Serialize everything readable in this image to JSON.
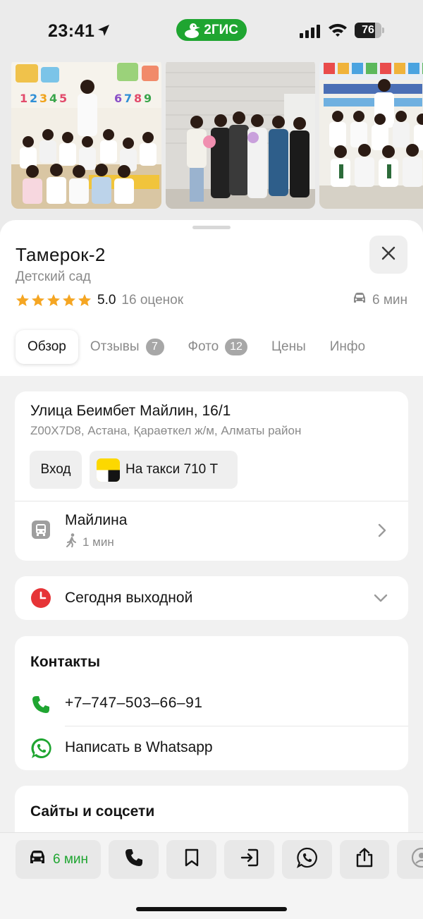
{
  "status_bar": {
    "time": "23:41",
    "brand_label": "2ГИС",
    "battery_level": 76,
    "battery_text": "76",
    "icons": [
      "location-arrow-icon",
      "cellular-signal-icon",
      "wifi-icon",
      "battery-icon"
    ]
  },
  "photos": [
    {
      "name": "group-photo-classroom"
    },
    {
      "name": "group-photo-teachers"
    },
    {
      "name": "group-photo-children"
    }
  ],
  "place": {
    "title": "Тамерок-2",
    "category": "Детский сад",
    "rating": "5.0",
    "stars": 5,
    "reviews_count": "16 оценок",
    "travel_time": "6 мин"
  },
  "tabs": [
    {
      "label": "Обзор",
      "badge": null,
      "active": true
    },
    {
      "label": "Отзывы",
      "badge": "7",
      "active": false
    },
    {
      "label": "Фото",
      "badge": "12",
      "active": false
    },
    {
      "label": "Цены",
      "badge": null,
      "active": false
    },
    {
      "label": "Инфо",
      "badge": null,
      "active": false
    }
  ],
  "address": {
    "street": "Улица Беимбет Майлин, 16/1",
    "detail": "Z00X7D8, Астана, Қараөткел ж/м, Алматы район",
    "entrance_label": "Вход",
    "taxi_label": "На такси 710 Т"
  },
  "transit": {
    "stop_name": "Майлина",
    "walk_time": "1 мин"
  },
  "hours": {
    "text": "Сегодня выходной"
  },
  "contacts": {
    "heading": "Контакты",
    "phone": "+7‒747‒503‒66‒91",
    "whatsapp_label": "Написать в Whatsapp"
  },
  "sites": {
    "heading": "Сайты и соцсети"
  },
  "action_bar": {
    "route_time": "6 мин",
    "icons": [
      "car-icon",
      "phone-icon",
      "bookmark-icon",
      "entrance-icon",
      "whatsapp-icon",
      "share-icon",
      "profile-icon"
    ]
  },
  "colors": {
    "brand_green": "#1fa531",
    "star_yellow": "#f5a623",
    "clock_red": "#e63437",
    "taxi_yellow": "#fcd800"
  }
}
